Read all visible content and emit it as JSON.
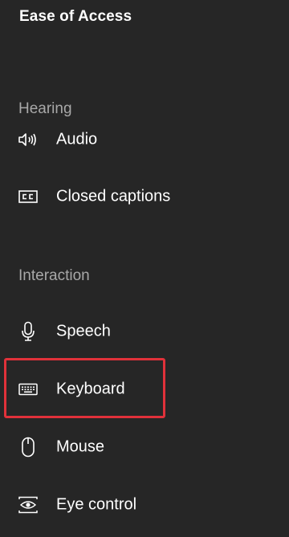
{
  "header": {
    "title": "Ease of Access"
  },
  "sections": {
    "hearing": {
      "label": "Hearing",
      "items": [
        {
          "label": "Audio",
          "icon": "audio-icon"
        },
        {
          "label": "Closed captions",
          "icon": "closed-captions-icon"
        }
      ]
    },
    "interaction": {
      "label": "Interaction",
      "items": [
        {
          "label": "Speech",
          "icon": "microphone-icon"
        },
        {
          "label": "Keyboard",
          "icon": "keyboard-icon"
        },
        {
          "label": "Mouse",
          "icon": "mouse-icon"
        },
        {
          "label": "Eye control",
          "icon": "eye-control-icon"
        }
      ]
    }
  },
  "colors": {
    "background": "#262626",
    "highlight": "#e0313a",
    "section_header": "#a8a8a8"
  }
}
